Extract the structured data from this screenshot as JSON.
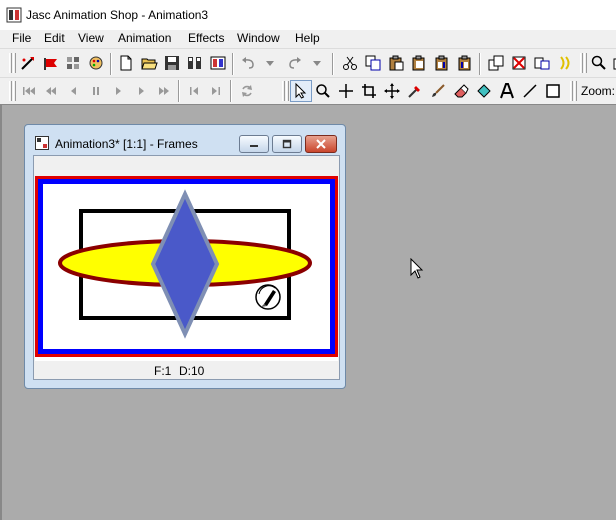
{
  "app": {
    "title": "Jasc Animation Shop - Animation3"
  },
  "menubar": {
    "items": [
      "File",
      "Edit",
      "View",
      "Animation",
      "Effects",
      "Window",
      "Help"
    ]
  },
  "toolbar": {
    "zoom_label": "Zoom:"
  },
  "frame_window": {
    "title": "Animation3* [1:1] - Frames",
    "status": {
      "frame": "F:1",
      "delay": "D:10"
    }
  },
  "colors": {
    "workspace": "#ababab",
    "frame_border_red": "#e00000",
    "frame_border_blue": "#0000ff",
    "ellipse_fill": "#ffff00",
    "ellipse_outline": "#8b0000",
    "diamond_fill": "#4a59c9",
    "diamond_outline": "#7f8fb4"
  }
}
